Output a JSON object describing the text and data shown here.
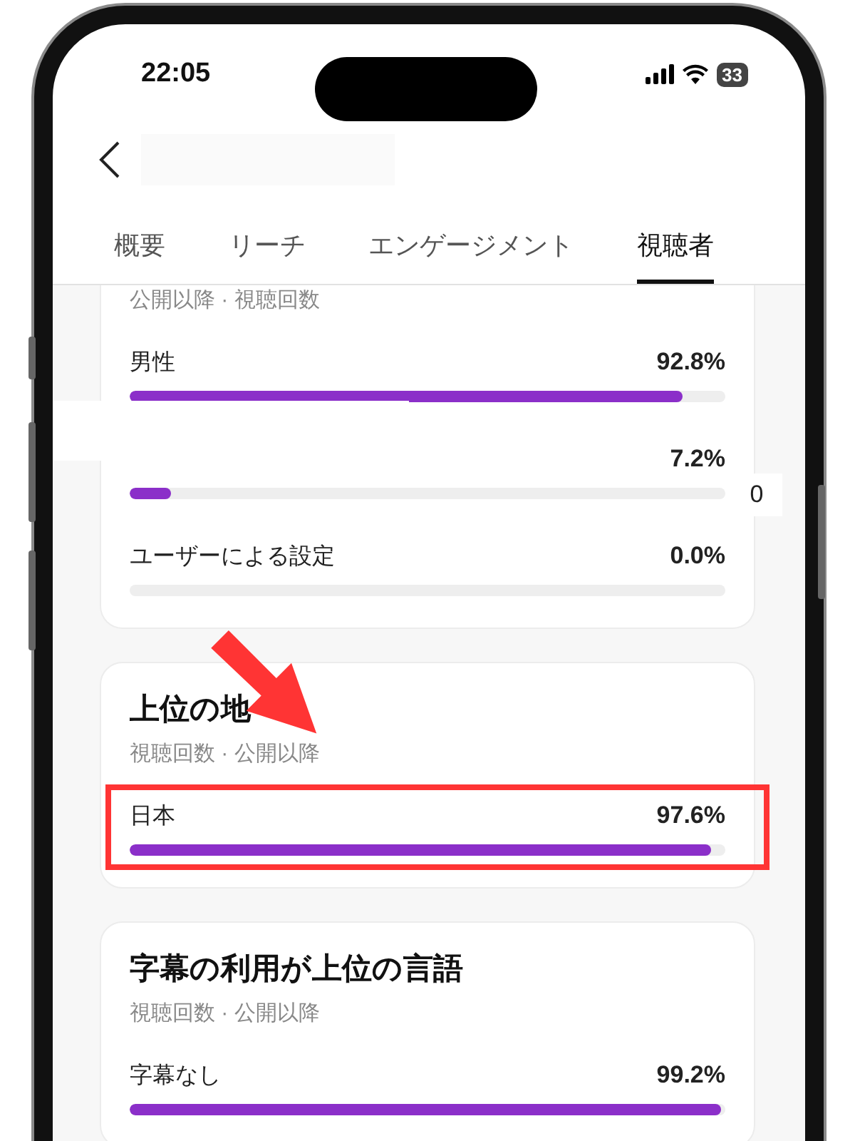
{
  "status_bar": {
    "time": "22:05",
    "battery": "33"
  },
  "tabs": [
    {
      "label": "概要",
      "selected": false
    },
    {
      "label": "リーチ",
      "selected": false
    },
    {
      "label": "エンゲージメント",
      "selected": false
    },
    {
      "label": "視聴者",
      "selected": true
    }
  ],
  "cards": [
    {
      "subtitle": "公開以降 · 視聴回数",
      "highlighted": false,
      "rows": [
        {
          "label": "男性",
          "value": "92.8%",
          "level": 0.928
        },
        {
          "value": "7.2%",
          "level": 0.07
        },
        {
          "label": "ユーザーによる設定",
          "value": "0.0%",
          "level": 0
        }
      ]
    },
    {
      "title": "上位の地",
      "subtitle": "視聴回数 · 公開以降",
      "highlighted": true,
      "rows": [
        {
          "label": "日本",
          "value": "97.6%",
          "level": 0.976
        }
      ]
    },
    {
      "title": "字幕の利用が上位の言語",
      "subtitle": "視聴回数 · 公開以降",
      "highlighted": false,
      "rows": [
        {
          "label": "字幕なし",
          "value": "99.2%",
          "level": 0.992
        }
      ]
    }
  ],
  "overlay_text": "0"
}
